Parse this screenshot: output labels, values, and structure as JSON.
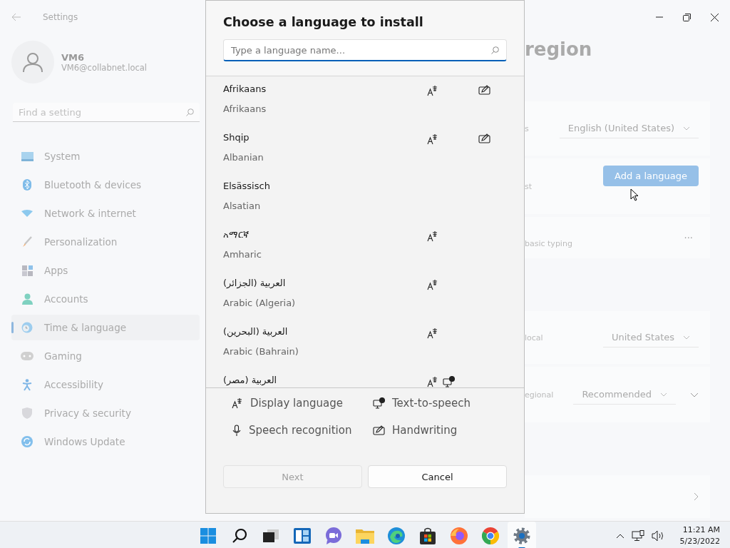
{
  "window": {
    "title": "Settings"
  },
  "account": {
    "name": "VM6",
    "email": "VM6@collabnet.local"
  },
  "sidebar": {
    "search": {
      "placeholder": "Find a setting"
    },
    "items": [
      {
        "label": "System",
        "selected": false
      },
      {
        "label": "Bluetooth & devices",
        "selected": false
      },
      {
        "label": "Network & internet",
        "selected": false
      },
      {
        "label": "Personalization",
        "selected": false
      },
      {
        "label": "Apps",
        "selected": false
      },
      {
        "label": "Accounts",
        "selected": false
      },
      {
        "label": "Time & language",
        "selected": true
      },
      {
        "label": "Gaming",
        "selected": false
      },
      {
        "label": "Accessibility",
        "selected": false
      },
      {
        "label": "Privacy & security",
        "selected": false
      },
      {
        "label": "Windows Update",
        "selected": false
      }
    ]
  },
  "page": {
    "title": "region",
    "cards": [
      {
        "kind": "dropdown",
        "label": "s",
        "value": "English (United States)"
      },
      {
        "kind": "button",
        "label": "st",
        "value": "Add a language"
      },
      {
        "kind": "more",
        "label": "basic typing",
        "value": "···"
      },
      {
        "kind": "gap"
      },
      {
        "kind": "dropdown",
        "label": "local",
        "value": "United States"
      },
      {
        "kind": "dropdown-expand",
        "label": "egional",
        "value": "Recommended"
      },
      {
        "kind": "gap"
      },
      {
        "kind": "link"
      }
    ]
  },
  "dialog": {
    "title": "Choose a language to install",
    "search": {
      "placeholder": "Type a language name..."
    },
    "languages": [
      {
        "native": "Afrikaans",
        "english": "Afrikaans",
        "display_language": true,
        "text_to_speech": false,
        "handwriting": true
      },
      {
        "native": "Shqip",
        "english": "Albanian",
        "display_language": true,
        "text_to_speech": false,
        "handwriting": true
      },
      {
        "native": "Elsässisch",
        "english": "Alsatian",
        "display_language": false,
        "text_to_speech": false,
        "handwriting": false
      },
      {
        "native": "አማርኛ",
        "english": "Amharic",
        "display_language": true,
        "text_to_speech": false,
        "handwriting": false
      },
      {
        "native": "العربية (الجزائر)",
        "english": "Arabic (Algeria)",
        "display_language": true,
        "text_to_speech": false,
        "handwriting": false
      },
      {
        "native": "العربية (البحرين)",
        "english": "Arabic (Bahrain)",
        "display_language": true,
        "text_to_speech": false,
        "handwriting": false
      },
      {
        "native": "العربية (مصر)",
        "display_language": true,
        "text_to_speech": true,
        "handwriting": false
      }
    ],
    "legend": [
      {
        "kind": "display_language",
        "label": "Display language"
      },
      {
        "kind": "text_to_speech",
        "label": "Text-to-speech"
      },
      {
        "kind": "speech_recognition",
        "label": "Speech recognition"
      },
      {
        "kind": "handwriting",
        "label": "Handwriting"
      }
    ],
    "buttons": [
      {
        "label": "Next",
        "disabled": true
      },
      {
        "label": "Cancel",
        "disabled": false
      }
    ]
  },
  "taskbar": {
    "apps": [
      {
        "kind": "start",
        "selected": false
      },
      {
        "kind": "search",
        "selected": false
      },
      {
        "kind": "taskview",
        "selected": false
      },
      {
        "kind": "widgets",
        "selected": false
      },
      {
        "kind": "chat",
        "selected": false
      },
      {
        "kind": "explorer",
        "selected": false
      },
      {
        "kind": "edge",
        "selected": false
      },
      {
        "kind": "store",
        "selected": false
      },
      {
        "kind": "firefox",
        "selected": false
      },
      {
        "kind": "chrome",
        "selected": false
      },
      {
        "kind": "settings",
        "selected": true
      }
    ],
    "time": "11:21 AM",
    "date": "5/23/2022"
  }
}
